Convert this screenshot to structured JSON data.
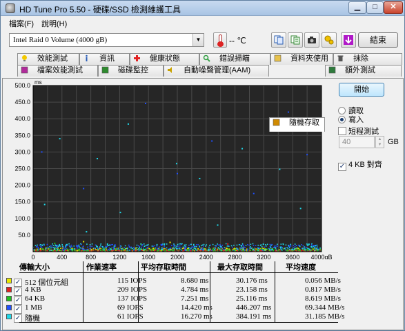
{
  "window": {
    "title": "HD Tune Pro 5.50 - 硬碟/SSD 檢測維護工具"
  },
  "menu": [
    "檔案(F)",
    "說明(H)"
  ],
  "toolbar": {
    "drive": "Intel  Raid 0 Volume (4000 gB)",
    "temperature": "-- ℃",
    "exit_label": "結束",
    "buttons": [
      "copy-info-icon",
      "copy-text-icon",
      "camera-icon",
      "settings-icon",
      "download-icon"
    ]
  },
  "tabs": {
    "row1": [
      {
        "label": "效能測試",
        "icon": "bulb-icon",
        "color": "#f2c800"
      },
      {
        "label": "資訊",
        "icon": "info-icon",
        "color": "#2c5fb8"
      },
      {
        "label": "健康狀態",
        "icon": "health-cross-icon",
        "color": "#e22222"
      },
      {
        "label": "錯誤掃瞄",
        "icon": "magnifier-icon",
        "color": "#3aa34a"
      },
      {
        "label": "資料夾使用",
        "icon": "folder-icon",
        "color": "#e7c14a"
      },
      {
        "label": "抹除",
        "icon": "trash-icon",
        "color": "#555555"
      }
    ],
    "row2": [
      {
        "label": "檔案效能測試",
        "icon": "file-bench-icon",
        "color": "#b02a9a"
      },
      {
        "label": "磁碟監控",
        "icon": "monitor-icon",
        "color": "#2e8b2e"
      },
      {
        "label": "自動噪聲管理(AAM)",
        "icon": "speaker-icon",
        "color": "#c8a200"
      },
      {
        "label": "隨機存取",
        "icon": "random-access-icon",
        "color": "#d08a00",
        "active": true
      },
      {
        "label": "額外測試",
        "icon": "grid-icon",
        "color": "#2e7a3c"
      }
    ]
  },
  "controls": {
    "start_label": "開始",
    "read_label": "讀取",
    "write_label": "寫入",
    "mode": "write",
    "short_test_label": "短程測試",
    "short_test_checked": false,
    "size_value": "40",
    "size_unit": "GB",
    "align_label": "4 KB 對齊",
    "align_checked": true
  },
  "chart_data": {
    "type": "scatter",
    "y_unit": "ms",
    "x_unit": "gB",
    "xlim": [
      0,
      4000
    ],
    "ylim": [
      0,
      500
    ],
    "x_ticks": [
      "0",
      "400",
      "800",
      "1200",
      "1600",
      "2000",
      "2400",
      "2800",
      "3200",
      "3600",
      "4000gB"
    ],
    "y_ticks": [
      "50.0",
      "100.0",
      "150.0",
      "200.0",
      "250.0",
      "300.0",
      "350.0",
      "400.0",
      "450.0",
      "500.0"
    ],
    "series": [
      {
        "name": "512 個位元組",
        "color": "#e8e800",
        "band": [
          2,
          11
        ],
        "outliers": [
          [
            700,
            30.2
          ],
          [
            1900,
            28
          ]
        ]
      },
      {
        "name": "4 KB",
        "color": "#e02020",
        "band": [
          1,
          6
        ],
        "outliers": [
          [
            2700,
            23.2
          ]
        ]
      },
      {
        "name": "64 KB",
        "color": "#20c020",
        "band": [
          2,
          9
        ],
        "outliers": [
          [
            300,
            25.1
          ],
          [
            1500,
            22
          ]
        ]
      },
      {
        "name": "1 MB",
        "color": "#2050ff",
        "band": [
          4,
          22
        ],
        "outliers": [
          [
            1560,
            446
          ],
          [
            3540,
            420
          ],
          [
            2480,
            333
          ],
          [
            120,
            300
          ],
          [
            3800,
            292
          ],
          [
            2000,
            235
          ],
          [
            700,
            190
          ],
          [
            3060,
            175
          ]
        ]
      },
      {
        "name": "隨機",
        "color": "#20d8e8",
        "band": [
          4,
          24
        ],
        "outliers": [
          [
            1320,
            384
          ],
          [
            370,
            340
          ],
          [
            2900,
            310
          ],
          [
            890,
            280
          ],
          [
            1990,
            265
          ],
          [
            3420,
            248
          ],
          [
            2310,
            220
          ],
          [
            160,
            142
          ],
          [
            3710,
            130
          ],
          [
            1210,
            118
          ],
          [
            2560,
            80
          ],
          [
            740,
            60
          ]
        ]
      }
    ]
  },
  "table": {
    "headers": [
      "傳輸大小",
      "作業速率",
      "平均存取時間",
      "最大存取時間",
      "平均速度"
    ],
    "rows": [
      {
        "size": "512 個位元組",
        "rate": "115 IOPS",
        "avg": "8.680 ms",
        "max": "30.176 ms",
        "speed": "0.056 MB/s",
        "color": "#e8e800"
      },
      {
        "size": "4 KB",
        "rate": "209 IOPS",
        "avg": "4.784 ms",
        "max": "23.158 ms",
        "speed": "0.817 MB/s",
        "color": "#e02020"
      },
      {
        "size": "64 KB",
        "rate": "137 IOPS",
        "avg": "7.251 ms",
        "max": "25.116 ms",
        "speed": "8.619 MB/s",
        "color": "#20c020"
      },
      {
        "size": "1 MB",
        "rate": "69 IOPS",
        "avg": "14.420 ms",
        "max": "446.207 ms",
        "speed": "69.344 MB/s",
        "color": "#2050ff"
      },
      {
        "size": "隨機",
        "rate": "61 IOPS",
        "avg": "16.270 ms",
        "max": "384.191 ms",
        "speed": "31.185 MB/s",
        "color": "#20d8e8"
      }
    ]
  }
}
